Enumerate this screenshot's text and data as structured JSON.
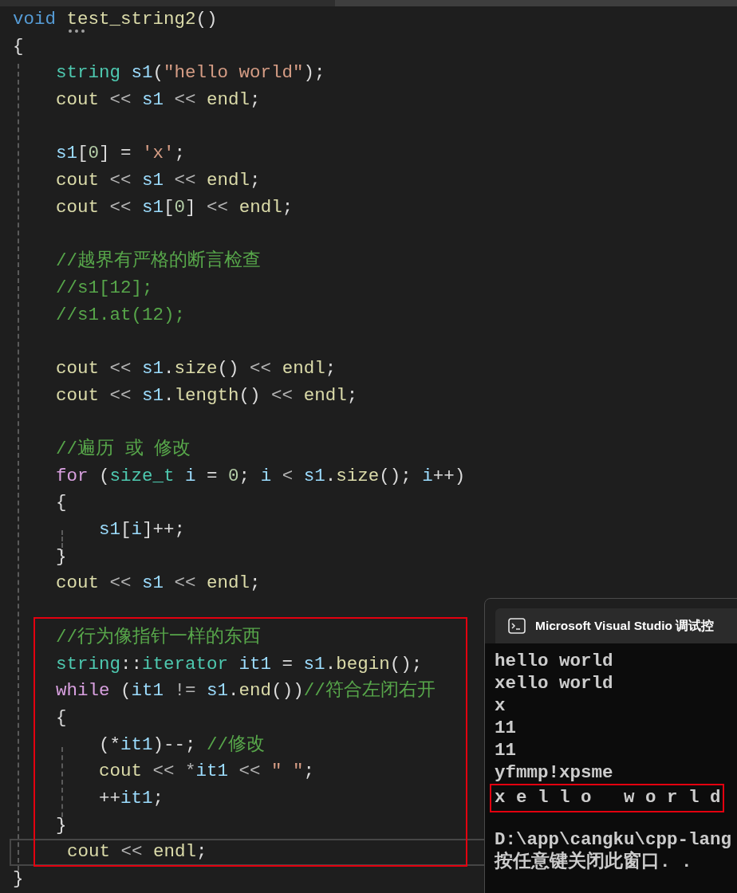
{
  "editor": {
    "blocks": [
      {
        "marked": false,
        "lines": [
          {
            "kind": "code",
            "tokens": [
              {
                "text": "void ",
                "kind": "keyword"
              },
              {
                "text": "test_string2",
                "kind": "func",
                "hint": true
              },
              {
                "text": "()",
                "kind": "plain"
              }
            ]
          },
          {
            "kind": "code",
            "tokens": [
              {
                "text": "{",
                "kind": "plain"
              }
            ]
          },
          {
            "kind": "code",
            "tokens": [
              {
                "text": "    string ",
                "kind": "type"
              },
              {
                "text": "s1",
                "kind": "var"
              },
              {
                "text": "(",
                "kind": "plain"
              },
              {
                "text": "\"hello world\"",
                "kind": "string"
              },
              {
                "text": ");",
                "kind": "plain"
              }
            ]
          },
          {
            "kind": "code",
            "tokens": [
              {
                "text": "    cout",
                "kind": "func"
              },
              {
                "text": " << ",
                "kind": "op"
              },
              {
                "text": "s1",
                "kind": "var"
              },
              {
                "text": " << ",
                "kind": "op"
              },
              {
                "text": "endl",
                "kind": "func"
              },
              {
                "text": ";",
                "kind": "plain"
              }
            ]
          },
          {
            "kind": "blank"
          },
          {
            "kind": "code",
            "tokens": [
              {
                "text": "    s1",
                "kind": "var"
              },
              {
                "text": "[",
                "kind": "plain"
              },
              {
                "text": "0",
                "kind": "num"
              },
              {
                "text": "] = ",
                "kind": "plain"
              },
              {
                "text": "'x'",
                "kind": "string"
              },
              {
                "text": ";",
                "kind": "plain"
              }
            ]
          },
          {
            "kind": "code",
            "tokens": [
              {
                "text": "    cout",
                "kind": "func"
              },
              {
                "text": " << ",
                "kind": "op"
              },
              {
                "text": "s1",
                "kind": "var"
              },
              {
                "text": " << ",
                "kind": "op"
              },
              {
                "text": "endl",
                "kind": "func"
              },
              {
                "text": ";",
                "kind": "plain"
              }
            ]
          },
          {
            "kind": "code",
            "tokens": [
              {
                "text": "    cout",
                "kind": "func"
              },
              {
                "text": " << ",
                "kind": "op"
              },
              {
                "text": "s1",
                "kind": "var"
              },
              {
                "text": "[",
                "kind": "plain"
              },
              {
                "text": "0",
                "kind": "num"
              },
              {
                "text": "]",
                "kind": "plain"
              },
              {
                "text": " << ",
                "kind": "op"
              },
              {
                "text": "endl",
                "kind": "func"
              },
              {
                "text": ";",
                "kind": "plain"
              }
            ]
          },
          {
            "kind": "blank"
          },
          {
            "kind": "code",
            "tokens": [
              {
                "text": "    //越界有严格的断言检查",
                "kind": "comment"
              }
            ]
          },
          {
            "kind": "code",
            "tokens": [
              {
                "text": "    //s1[12];",
                "kind": "comment"
              }
            ]
          },
          {
            "kind": "code",
            "tokens": [
              {
                "text": "    //s1.at(12);",
                "kind": "comment"
              }
            ]
          },
          {
            "kind": "blank"
          },
          {
            "kind": "code",
            "tokens": [
              {
                "text": "    cout",
                "kind": "func"
              },
              {
                "text": " << ",
                "kind": "op"
              },
              {
                "text": "s1",
                "kind": "var"
              },
              {
                "text": ".",
                "kind": "plain"
              },
              {
                "text": "size",
                "kind": "func"
              },
              {
                "text": "()",
                "kind": "plain"
              },
              {
                "text": " << ",
                "kind": "op"
              },
              {
                "text": "endl",
                "kind": "func"
              },
              {
                "text": ";",
                "kind": "plain"
              }
            ]
          },
          {
            "kind": "code",
            "tokens": [
              {
                "text": "    cout",
                "kind": "func"
              },
              {
                "text": " << ",
                "kind": "op"
              },
              {
                "text": "s1",
                "kind": "var"
              },
              {
                "text": ".",
                "kind": "plain"
              },
              {
                "text": "length",
                "kind": "func"
              },
              {
                "text": "()",
                "kind": "plain"
              },
              {
                "text": " << ",
                "kind": "op"
              },
              {
                "text": "endl",
                "kind": "func"
              },
              {
                "text": ";",
                "kind": "plain"
              }
            ]
          },
          {
            "kind": "blank"
          },
          {
            "kind": "code",
            "tokens": [
              {
                "text": "    //遍历 或 修改",
                "kind": "comment"
              }
            ]
          },
          {
            "kind": "code",
            "tokens": [
              {
                "text": "    for ",
                "kind": "control"
              },
              {
                "text": "(",
                "kind": "plain"
              },
              {
                "text": "size_t ",
                "kind": "type"
              },
              {
                "text": "i",
                "kind": "var"
              },
              {
                "text": " = ",
                "kind": "plain"
              },
              {
                "text": "0",
                "kind": "num"
              },
              {
                "text": "; ",
                "kind": "plain"
              },
              {
                "text": "i",
                "kind": "var"
              },
              {
                "text": " < ",
                "kind": "op"
              },
              {
                "text": "s1",
                "kind": "var"
              },
              {
                "text": ".",
                "kind": "plain"
              },
              {
                "text": "size",
                "kind": "func"
              },
              {
                "text": "(); ",
                "kind": "plain"
              },
              {
                "text": "i",
                "kind": "var"
              },
              {
                "text": "++)",
                "kind": "plain"
              }
            ]
          },
          {
            "kind": "code",
            "tokens": [
              {
                "text": "    {",
                "kind": "plain"
              }
            ]
          },
          {
            "kind": "code",
            "tokens": [
              {
                "text": "        s1",
                "kind": "var"
              },
              {
                "text": "[",
                "kind": "plain"
              },
              {
                "text": "i",
                "kind": "var"
              },
              {
                "text": "]++;",
                "kind": "plain"
              }
            ]
          },
          {
            "kind": "code",
            "tokens": [
              {
                "text": "    }",
                "kind": "plain"
              }
            ]
          },
          {
            "kind": "code",
            "tokens": [
              {
                "text": "    cout",
                "kind": "func"
              },
              {
                "text": " << ",
                "kind": "op"
              },
              {
                "text": "s1",
                "kind": "var"
              },
              {
                "text": " << ",
                "kind": "op"
              },
              {
                "text": "endl",
                "kind": "func"
              },
              {
                "text": ";",
                "kind": "plain"
              }
            ]
          },
          {
            "kind": "blank"
          }
        ]
      },
      {
        "marked": true,
        "lines": [
          {
            "kind": "code",
            "tokens": [
              {
                "text": "    //行为像指针一样的东西",
                "kind": "comment"
              }
            ]
          },
          {
            "kind": "code",
            "tokens": [
              {
                "text": "    string",
                "kind": "type"
              },
              {
                "text": "::",
                "kind": "plain"
              },
              {
                "text": "iterator ",
                "kind": "type"
              },
              {
                "text": "it1",
                "kind": "var"
              },
              {
                "text": " = ",
                "kind": "plain"
              },
              {
                "text": "s1",
                "kind": "var"
              },
              {
                "text": ".",
                "kind": "plain"
              },
              {
                "text": "begin",
                "kind": "func"
              },
              {
                "text": "();",
                "kind": "plain"
              }
            ]
          },
          {
            "kind": "code",
            "tokens": [
              {
                "text": "    while ",
                "kind": "control"
              },
              {
                "text": "(",
                "kind": "plain"
              },
              {
                "text": "it1",
                "kind": "var"
              },
              {
                "text": " != ",
                "kind": "op"
              },
              {
                "text": "s1",
                "kind": "var"
              },
              {
                "text": ".",
                "kind": "plain"
              },
              {
                "text": "end",
                "kind": "func"
              },
              {
                "text": "())",
                "kind": "plain"
              },
              {
                "text": "//符合左闭右开",
                "kind": "comment"
              }
            ]
          },
          {
            "kind": "code",
            "tokens": [
              {
                "text": "    {",
                "kind": "plain"
              }
            ]
          },
          {
            "kind": "code",
            "tokens": [
              {
                "text": "        (*",
                "kind": "plain"
              },
              {
                "text": "it1",
                "kind": "var"
              },
              {
                "text": ")--; ",
                "kind": "plain"
              },
              {
                "text": "//修改",
                "kind": "comment"
              }
            ]
          },
          {
            "kind": "code",
            "tokens": [
              {
                "text": "        cout",
                "kind": "func"
              },
              {
                "text": " << *",
                "kind": "op"
              },
              {
                "text": "it1",
                "kind": "var"
              },
              {
                "text": " << ",
                "kind": "op"
              },
              {
                "text": "\" \"",
                "kind": "string"
              },
              {
                "text": ";",
                "kind": "plain"
              }
            ]
          },
          {
            "kind": "code",
            "tokens": [
              {
                "text": "        ++",
                "kind": "plain"
              },
              {
                "text": "it1",
                "kind": "var"
              },
              {
                "text": ";",
                "kind": "plain"
              }
            ]
          },
          {
            "kind": "code",
            "tokens": [
              {
                "text": "    }",
                "kind": "plain"
              }
            ]
          },
          {
            "kind": "code",
            "current": true,
            "tokens": [
              {
                "text": "    cout",
                "kind": "func"
              },
              {
                "text": " << ",
                "kind": "op"
              },
              {
                "text": "endl",
                "kind": "func"
              },
              {
                "text": ";",
                "kind": "plain"
              }
            ]
          }
        ]
      },
      {
        "marked": false,
        "lines": [
          {
            "kind": "code",
            "tokens": [
              {
                "text": "}",
                "kind": "plain"
              }
            ]
          }
        ]
      }
    ]
  },
  "console": {
    "title": "Microsoft Visual Studio 调试控",
    "output": [
      {
        "kind": "text",
        "text": "hello world",
        "marked": false
      },
      {
        "kind": "text",
        "text": "xello world",
        "marked": false
      },
      {
        "kind": "text",
        "text": "x",
        "marked": false
      },
      {
        "kind": "text",
        "text": "11",
        "marked": false
      },
      {
        "kind": "text",
        "text": "11",
        "marked": false
      },
      {
        "kind": "text",
        "text": "yfmmp!xpsme",
        "marked": false
      },
      {
        "kind": "text",
        "text": "x e l l o   w o r l d",
        "marked": true
      },
      {
        "kind": "blank"
      },
      {
        "kind": "text",
        "text": "D:\\app\\cangku\\cpp-lang",
        "marked": false
      },
      {
        "kind": "text",
        "text": "按任意键关闭此窗口. .",
        "marked": false
      }
    ]
  }
}
